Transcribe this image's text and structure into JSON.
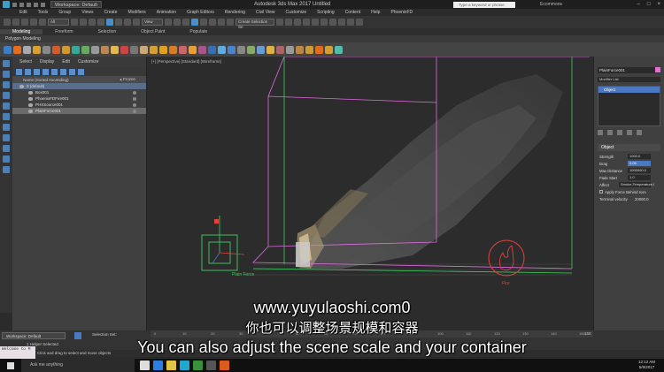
{
  "titlebar": {
    "workspace": "Workspace: Default",
    "title": "Autodesk 3ds Max 2017     Untitled",
    "search_placeholder": "Type a keyword or phrase",
    "user": "Ecommons",
    "window_buttons": [
      "–",
      "□",
      "×"
    ]
  },
  "menubar": {
    "items": [
      "Edit",
      "Tools",
      "Group",
      "Views",
      "Create",
      "Modifiers",
      "Animation",
      "Graph Editors",
      "Rendering",
      "Civil View",
      "Customize",
      "Scripting",
      "Content",
      "Help",
      "PhoenixFD"
    ]
  },
  "toolbar": {
    "selection_filter": "All",
    "view_dropdown": "View",
    "create_selection_set": "Create Selection Se"
  },
  "ribbon": {
    "tabs": [
      "Modeling",
      "Freeform",
      "Selection",
      "Object Paint",
      "Populate"
    ],
    "active_tab": "Modeling",
    "subpanel": "Polygon Modeling"
  },
  "explorer": {
    "tabs": [
      "Select",
      "Display",
      "Edit",
      "Customize"
    ],
    "column_name": "Name (Sorted Ascending)",
    "column_frozen": "▴ Frozen",
    "rows": [
      {
        "label": "0 (default)",
        "state": "sel"
      },
      {
        "label": "Box001",
        "state": ""
      },
      {
        "label": "PhoenixFDFire001",
        "state": ""
      },
      {
        "label": "PHXSource001",
        "state": ""
      },
      {
        "label": "PlainForce001",
        "state": "sel2"
      }
    ]
  },
  "viewport": {
    "label": "[+] [Perspective] [Standard] [Wireframe]",
    "plain_force_label": "Plain Force",
    "fire_label": "Fire"
  },
  "right_panel": {
    "object_name": "PlainForce001",
    "modifier_list": "Modifier List",
    "stack_item": "Object",
    "rollout_title": "Object",
    "params": [
      {
        "label": "Strength",
        "value": "1000.0"
      },
      {
        "label": "Drag",
        "value": "0.05"
      },
      {
        "label": "Max Distance",
        "value": "1000000.0"
      },
      {
        "label": "Fade Start",
        "value": "1.0"
      }
    ],
    "affect_label": "Affect",
    "affect_value": "Smoke,Temperature,l",
    "apply_force_label": "Apply Force Behind Icon",
    "terminal_velocity_label": "Terminal velocity",
    "terminal_velocity_value": "20000.0"
  },
  "bottom": {
    "workspace": "Workspace: Default",
    "selection_set": "Selection Set:",
    "status_helper": "1 Helper Selected",
    "status_hint": "Click and drag to select and move objects",
    "welcome": "Welcome to M",
    "timeline_end": "150",
    "timeline_ticks": [
      "0",
      "10",
      "20",
      "30",
      "40",
      "50",
      "60",
      "70",
      "80",
      "90",
      "100",
      "110",
      "120",
      "130",
      "140",
      "150"
    ]
  },
  "taskbar": {
    "search_placeholder": "Ask me anything",
    "time": "12:12 AM",
    "date": "5/9/2017"
  },
  "subtitles": {
    "url": "www.yuyulaoshi.com0",
    "chinese": "你也可以调整场景规模和容器",
    "english": "You can also adjust the scene scale and your container"
  },
  "colors": {
    "selection_blue": "#4a78c2",
    "force_green": "#3ecf63",
    "fire_red": "#e2433a",
    "box_pink": "#e06be0"
  }
}
